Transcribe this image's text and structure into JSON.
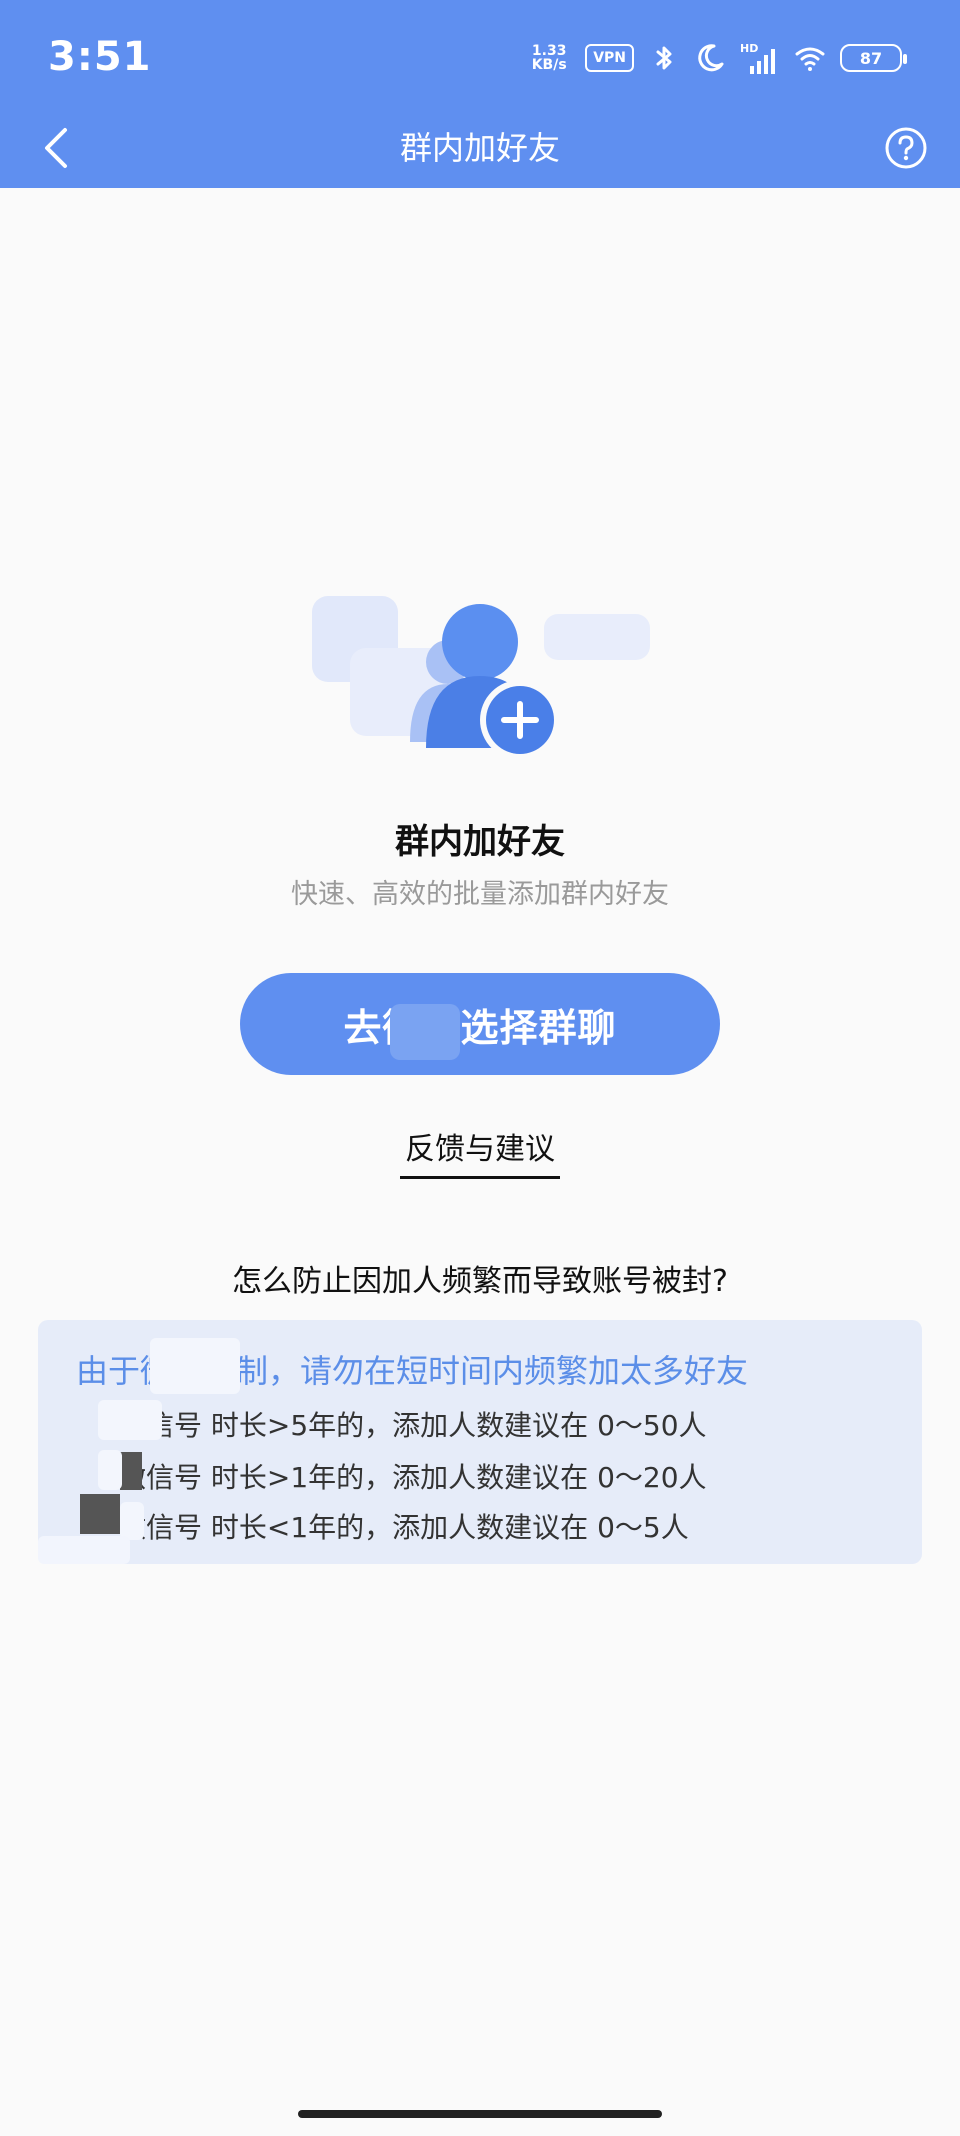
{
  "status_bar": {
    "time": "3:51",
    "net_speed_value": "1.33",
    "net_speed_unit": "KB/s",
    "vpn_label": "VPN",
    "hd_label": "HD",
    "battery_level": "87"
  },
  "nav": {
    "title": "群内加好友"
  },
  "feature": {
    "title": "群内加好友",
    "subtitle": "快速、高效的批量添加群内好友"
  },
  "primary_button": {
    "label": "去微信选择群聊"
  },
  "feedback_link": {
    "label": "反馈与建议"
  },
  "tips": {
    "question": "怎么防止因加人频繁而导致账号被封?",
    "headline": "由于微信限制，请勿在短时间内频繁加太多好友",
    "rows": [
      "微信号 时长>5年的，添加人数建议在 0～50人",
      "微信号 时长>1年的，添加人数建议在 0～20人",
      "微信号 时长<1年的，添加人数建议在 0～5人"
    ]
  },
  "colors": {
    "header": "#5f8ff0",
    "primary": "#5f8ff0",
    "tips_bg": "#e6ecf9",
    "tips_text": "#5b8ee8"
  }
}
